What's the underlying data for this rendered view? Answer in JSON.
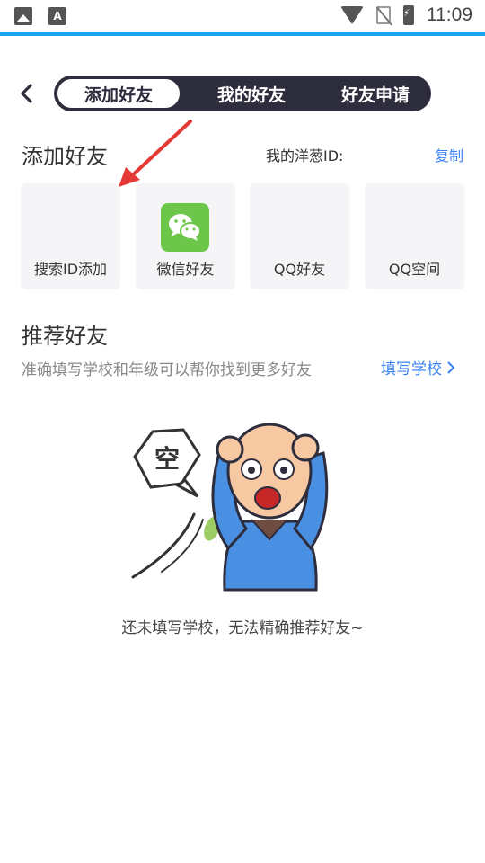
{
  "status_bar": {
    "time": "11:09",
    "icons": [
      "gallery-icon",
      "font-icon",
      "wifi-icon",
      "no-sim-icon",
      "battery-charging-icon"
    ]
  },
  "colors": {
    "accent": "#1aa3ee",
    "tab_bg": "#2d2d3e",
    "link": "#3b82f6",
    "wechat": "#6cc64a",
    "card_bg": "#f5f5f7"
  },
  "header": {
    "tabs": [
      {
        "label": "添加好友",
        "active": true
      },
      {
        "label": "我的好友",
        "active": false
      },
      {
        "label": "好友申请",
        "active": false
      }
    ]
  },
  "add_friend": {
    "title": "添加好友",
    "my_id_label": "我的洋葱ID:",
    "copy_label": "复制",
    "options": [
      {
        "label": "搜索ID添加",
        "icon": ""
      },
      {
        "label": "微信好友",
        "icon": "wechat-icon"
      },
      {
        "label": "QQ好友",
        "icon": ""
      },
      {
        "label": "QQ空间",
        "icon": ""
      }
    ]
  },
  "recommend": {
    "title": "推荐好友",
    "description": "准确填写学校和年级可以帮你找到更多好友",
    "fill_school_label": "填写学校",
    "empty_bubble_text": "空",
    "empty_text": "还未填写学校，无法精确推荐好友~"
  }
}
